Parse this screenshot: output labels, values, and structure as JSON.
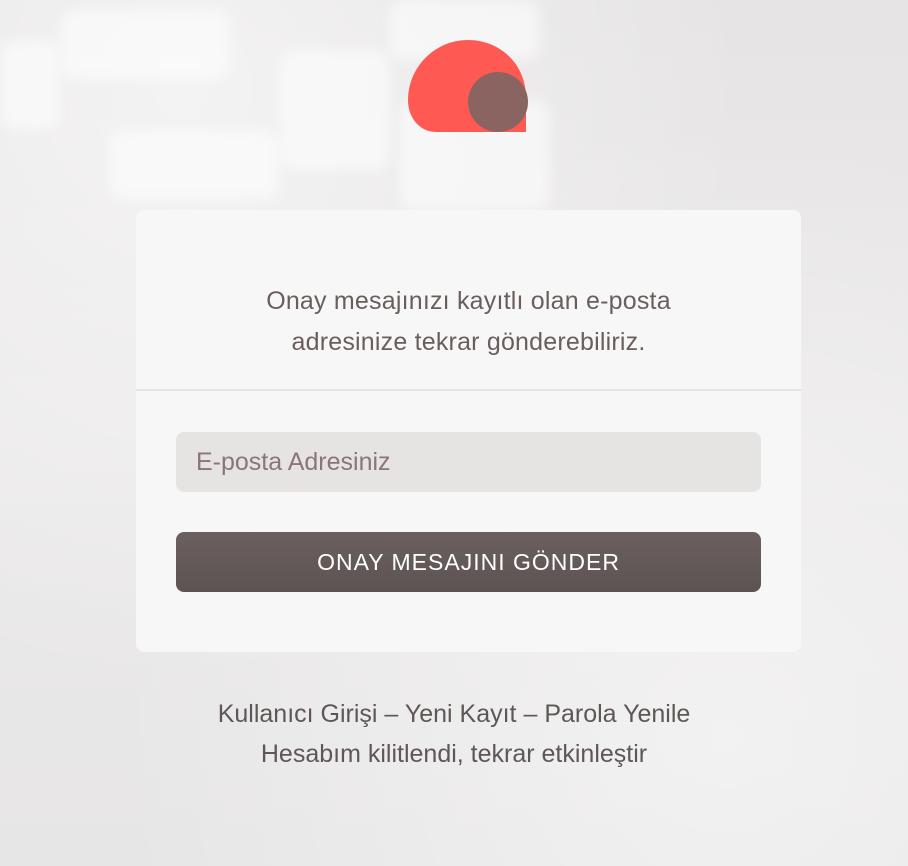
{
  "logo": {
    "name": "brand-logo",
    "primary_color": "#fe5a53",
    "secondary_color": "#8a6461"
  },
  "card": {
    "message_line1": "Onay mesajınızı kayıtlı olan e-posta",
    "message_line2": "adresinize tekrar gönderebiliriz.",
    "email_placeholder": "E-posta Adresiniz",
    "email_value": "",
    "submit_label": "ONAY MESAJINI GÖNDER"
  },
  "links": {
    "login": "Kullanıcı Girişi",
    "separator": "–",
    "register": "Yeni Kayıt",
    "reset_password": "Parola Yenile",
    "reactivate": "Hesabım kilitlendi, tekrar etkinleştir"
  },
  "colors": {
    "button_bg": "#655b5a",
    "input_bg": "#e5e4e3",
    "text": "#6a5e5d"
  }
}
